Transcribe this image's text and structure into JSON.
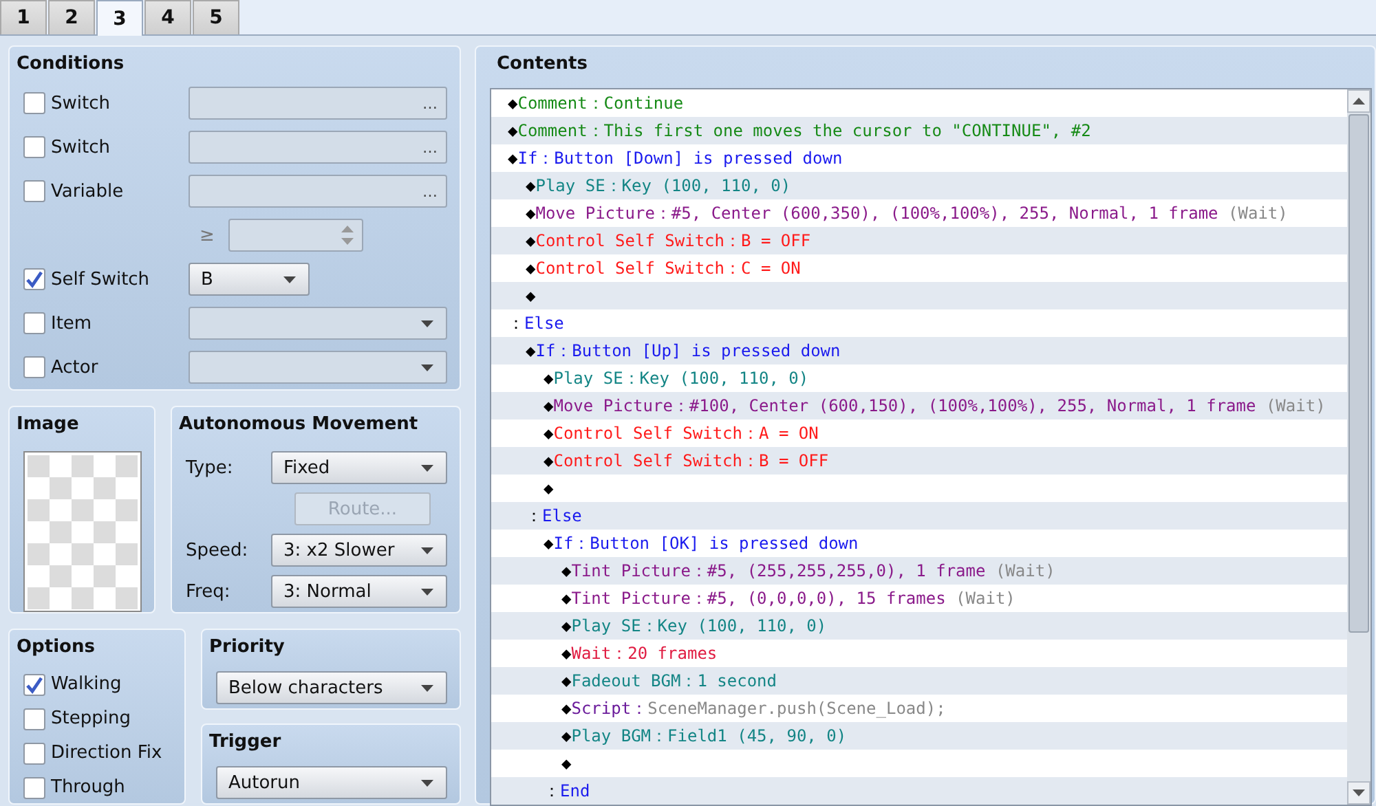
{
  "tabs": [
    {
      "label": "1",
      "selected": false
    },
    {
      "label": "2",
      "selected": false
    },
    {
      "label": "3",
      "selected": true
    },
    {
      "label": "4",
      "selected": false
    },
    {
      "label": "5",
      "selected": false
    }
  ],
  "conditions": {
    "title": "Conditions",
    "rows": [
      {
        "kind": "picker",
        "label": "Switch",
        "checked": false,
        "button": "…"
      },
      {
        "kind": "picker",
        "label": "Switch",
        "checked": false,
        "button": "…"
      },
      {
        "kind": "picker",
        "label": "Variable",
        "checked": false,
        "button": "…"
      },
      {
        "kind": "compare",
        "operator": "≥"
      },
      {
        "kind": "letter-select",
        "label": "Self Switch",
        "checked": true,
        "value": "B"
      },
      {
        "kind": "dropdown",
        "label": "Item",
        "checked": false
      },
      {
        "kind": "dropdown",
        "label": "Actor",
        "checked": false
      }
    ]
  },
  "image": {
    "title": "Image"
  },
  "movement": {
    "title": "Autonomous Movement",
    "fields": [
      {
        "kind": "dropdown",
        "label": "Type:",
        "value": "Fixed"
      },
      {
        "kind": "button",
        "label": "Route...",
        "disabled": true
      },
      {
        "kind": "dropdown",
        "label": "Speed:",
        "value": "3: x2 Slower"
      },
      {
        "kind": "dropdown",
        "label": "Freq:",
        "value": "3: Normal"
      }
    ]
  },
  "options": {
    "title": "Options",
    "items": [
      {
        "label": "Walking",
        "checked": true
      },
      {
        "label": "Stepping",
        "checked": false
      },
      {
        "label": "Direction Fix",
        "checked": false
      },
      {
        "label": "Through",
        "checked": false
      }
    ]
  },
  "priority": {
    "title": "Priority",
    "value": "Below characters"
  },
  "trigger": {
    "title": "Trigger",
    "value": "Autorun"
  },
  "contents": {
    "title": "Contents",
    "lines": [
      {
        "parts": [
          {
            "text": "◆",
            "kind": "marker"
          },
          {
            "text": "Comment：Continue",
            "kind": "comment"
          }
        ]
      },
      {
        "parts": [
          {
            "text": "◆",
            "kind": "marker"
          },
          {
            "text": "Comment：This first one moves the cursor to \"CONTINUE\", #2",
            "kind": "comment"
          }
        ]
      },
      {
        "parts": [
          {
            "text": "◆",
            "kind": "marker"
          },
          {
            "text": "If：Button [Down] is pressed down",
            "kind": "flow"
          }
        ],
        "children": [
          {
            "parts": [
              {
                "text": "◆",
                "kind": "marker"
              },
              {
                "text": "Play SE：Key (100, 110, 0)",
                "kind": "audio"
              }
            ]
          },
          {
            "parts": [
              {
                "text": "◆",
                "kind": "marker"
              },
              {
                "text": "Move Picture：#5, Center (600,350), (100%,100%), 255, Normal, 1 frame",
                "kind": "picture"
              },
              {
                "text": " (Wait)",
                "kind": "note"
              }
            ]
          },
          {
            "parts": [
              {
                "text": "◆",
                "kind": "marker"
              },
              {
                "text": "Control Self Switch：B = OFF",
                "kind": "switch"
              }
            ]
          },
          {
            "parts": [
              {
                "text": "◆",
                "kind": "marker"
              },
              {
                "text": "Control Self Switch：C = ON",
                "kind": "switch"
              }
            ]
          },
          {
            "parts": [
              {
                "text": "◆",
                "kind": "marker"
              }
            ]
          }
        ]
      },
      {
        "parts": [
          {
            "text": "：",
            "kind": "marker"
          },
          {
            "text": "Else",
            "kind": "flow"
          }
        ],
        "children": [
          {
            "parts": [
              {
                "text": "◆",
                "kind": "marker"
              },
              {
                "text": "If：Button [Up] is pressed down",
                "kind": "flow"
              }
            ],
            "children": [
              {
                "parts": [
                  {
                    "text": "◆",
                    "kind": "marker"
                  },
                  {
                    "text": "Play SE：Key (100, 110, 0)",
                    "kind": "audio"
                  }
                ]
              },
              {
                "parts": [
                  {
                    "text": "◆",
                    "kind": "marker"
                  },
                  {
                    "text": "Move Picture：#100, Center (600,150), (100%,100%), 255, Normal, 1 frame",
                    "kind": "picture"
                  },
                  {
                    "text": " (Wait)",
                    "kind": "note"
                  }
                ]
              },
              {
                "parts": [
                  {
                    "text": "◆",
                    "kind": "marker"
                  },
                  {
                    "text": "Control Self Switch：A = ON",
                    "kind": "switch"
                  }
                ]
              },
              {
                "parts": [
                  {
                    "text": "◆",
                    "kind": "marker"
                  },
                  {
                    "text": "Control Self Switch：B = OFF",
                    "kind": "switch"
                  }
                ]
              },
              {
                "parts": [
                  {
                    "text": "◆",
                    "kind": "marker"
                  }
                ]
              }
            ]
          },
          {
            "parts": [
              {
                "text": "：",
                "kind": "marker"
              },
              {
                "text": "Else",
                "kind": "flow"
              }
            ],
            "children": [
              {
                "parts": [
                  {
                    "text": "◆",
                    "kind": "marker"
                  },
                  {
                    "text": "If：Button [OK] is pressed down",
                    "kind": "flow"
                  }
                ],
                "children": [
                  {
                    "parts": [
                      {
                        "text": "◆",
                        "kind": "marker"
                      },
                      {
                        "text": "Tint Picture：#5, (255,255,255,0), 1 frame",
                        "kind": "picture"
                      },
                      {
                        "text": " (Wait)",
                        "kind": "note"
                      }
                    ]
                  },
                  {
                    "parts": [
                      {
                        "text": "◆",
                        "kind": "marker"
                      },
                      {
                        "text": "Tint Picture：#5, (0,0,0,0), 15 frames",
                        "kind": "picture"
                      },
                      {
                        "text": " (Wait)",
                        "kind": "note"
                      }
                    ]
                  },
                  {
                    "parts": [
                      {
                        "text": "◆",
                        "kind": "marker"
                      },
                      {
                        "text": "Play SE：Key (100, 110, 0)",
                        "kind": "audio"
                      }
                    ]
                  },
                  {
                    "parts": [
                      {
                        "text": "◆",
                        "kind": "marker"
                      },
                      {
                        "text": "Wait：20 frames",
                        "kind": "wait"
                      }
                    ]
                  },
                  {
                    "parts": [
                      {
                        "text": "◆",
                        "kind": "marker"
                      },
                      {
                        "text": "Fadeout BGM：1 second",
                        "kind": "audio"
                      }
                    ]
                  },
                  {
                    "parts": [
                      {
                        "text": "◆",
                        "kind": "marker"
                      },
                      {
                        "text": "Script：",
                        "kind": "script"
                      },
                      {
                        "text": "SceneManager.push(Scene_Load);",
                        "kind": "note"
                      }
                    ]
                  },
                  {
                    "parts": [
                      {
                        "text": "◆",
                        "kind": "marker"
                      },
                      {
                        "text": "Play BGM：Field1 (45, 90, 0)",
                        "kind": "audio"
                      }
                    ]
                  },
                  {
                    "parts": [
                      {
                        "text": "◆",
                        "kind": "marker"
                      }
                    ]
                  }
                ]
              },
              {
                "parts": [
                  {
                    "text": "：",
                    "kind": "marker"
                  },
                  {
                    "text": "End",
                    "kind": "flow"
                  }
                ]
              }
            ]
          }
        ]
      }
    ]
  }
}
